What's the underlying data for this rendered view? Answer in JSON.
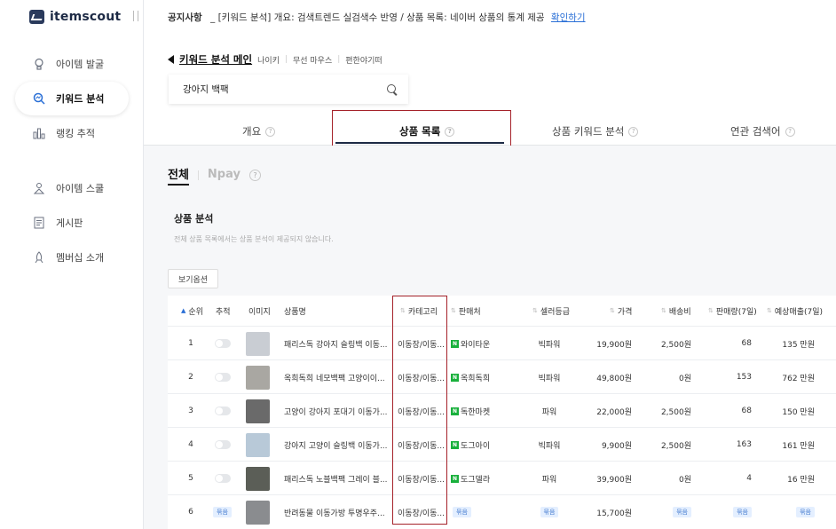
{
  "app": {
    "logo_text": "itemscout"
  },
  "sidebar": {
    "items": [
      {
        "label": "아이템 발굴",
        "icon": "lightbulb-icon"
      },
      {
        "label": "키워드 분석",
        "icon": "search-chart-icon",
        "active": true
      },
      {
        "label": "랭킹 추적",
        "icon": "bar-chart-icon"
      },
      {
        "label": "아이템 스쿨",
        "icon": "school-icon"
      },
      {
        "label": "게시판",
        "icon": "board-icon"
      },
      {
        "label": "멤버십 소개",
        "icon": "rocket-icon"
      }
    ]
  },
  "notice": {
    "label": "공지사항",
    "dash": "_",
    "text": "[키워드 분석] 개요: 검색트렌드 실검색수 반영 / 상품 목록: 네이버 상품의 통계 제공",
    "link": "확인하기"
  },
  "breadcrumb": {
    "main": "키워드 분석 메인",
    "recent": [
      "나이키",
      "무선 마우스",
      "편한야기떠"
    ]
  },
  "search": {
    "value": "강아지 백팩"
  },
  "tabs": [
    {
      "label": "개요"
    },
    {
      "label": "상품 목록",
      "active": true
    },
    {
      "label": "상품 키워드 분석"
    },
    {
      "label": "연관 검색어"
    }
  ],
  "subtabs": {
    "all": "전체",
    "npay": "Npay"
  },
  "section": {
    "title": "상품 분석",
    "note": "전체 상품 목록에서는 상품 분석이 제공되지 않습니다."
  },
  "options_button": "보기옵션",
  "table": {
    "headers": {
      "rank": "순위",
      "track": "추적",
      "image": "이미지",
      "name": "상품명",
      "category": "카테고리",
      "seller": "판매처",
      "grade": "셀러등급",
      "price": "가격",
      "shipping": "배송비",
      "sales": "판매량(7일)",
      "revenue": "예상매출(7일)"
    },
    "bundle_label": "묶음",
    "rows": [
      {
        "rank": "1",
        "name": "패리스독 강아지 슬링백 이동...",
        "category": "이동장/이동...",
        "seller": "와이타운",
        "grade": "빅파워",
        "price": "19,900원",
        "shipping": "2,500원",
        "sales": "68",
        "revenue": "135 만원",
        "thumb": "#c9cdd3"
      },
      {
        "rank": "2",
        "name": "옥희독희 네모백팩 고양이이...",
        "category": "이동장/이동...",
        "seller": "옥희독희",
        "grade": "빅파워",
        "price": "49,800원",
        "shipping": "0원",
        "sales": "153",
        "revenue": "762 만원",
        "thumb": "#a9a7a2"
      },
      {
        "rank": "3",
        "name": "고양이 강아지 포대기 이동가...",
        "category": "이동장/이동...",
        "seller": "독한마켓",
        "grade": "파워",
        "price": "22,000원",
        "shipping": "2,500원",
        "sales": "68",
        "revenue": "150 만원",
        "thumb": "#6a6a6a"
      },
      {
        "rank": "4",
        "name": "강아지 고양이 슬링백 이동가...",
        "category": "이동장/이동...",
        "seller": "도그아이",
        "grade": "빅파워",
        "price": "9,900원",
        "shipping": "2,500원",
        "sales": "163",
        "revenue": "161 만원",
        "thumb": "#b8c9d8"
      },
      {
        "rank": "5",
        "name": "패리스독 노블백팩 그레이 블...",
        "category": "이동장/이동...",
        "seller": "도그델라",
        "grade": "파워",
        "price": "39,900원",
        "shipping": "0원",
        "sales": "4",
        "revenue": "16 만원",
        "thumb": "#5b5e57"
      },
      {
        "rank": "6",
        "name": "반려동물 이동가방 투명우주...",
        "category": "이동장/이동...",
        "seller": "",
        "grade": "",
        "price": "15,700원",
        "shipping": "",
        "sales": "",
        "revenue": "",
        "thumb": "#8a8c8f",
        "bundle": true
      }
    ]
  },
  "colors": {
    "accent": "#1d2a45",
    "highlight": "#a5222a",
    "naver": "#19b03c"
  }
}
